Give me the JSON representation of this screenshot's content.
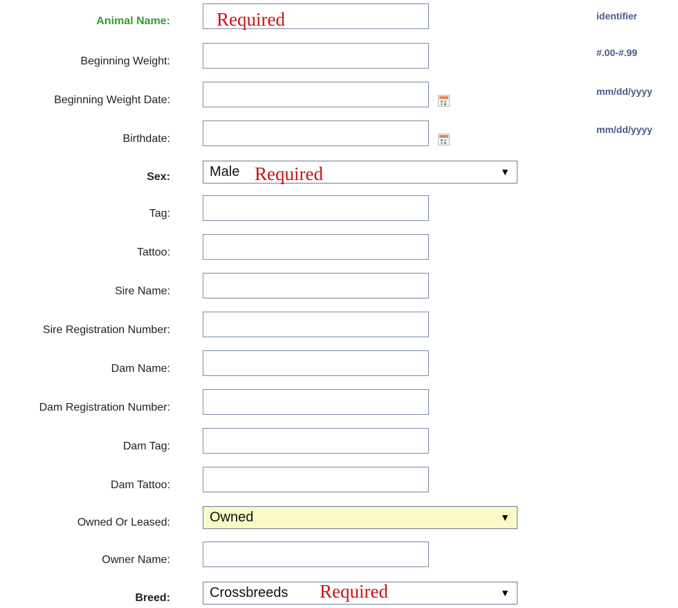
{
  "form": {
    "animal_name": {
      "label": "Animal Name:",
      "value": "",
      "required_note": "Required",
      "hint": "identifier"
    },
    "beginning_weight": {
      "label": "Beginning Weight:",
      "value": "",
      "hint": "#.00-#.99"
    },
    "beginning_weight_date": {
      "label": "Beginning Weight Date:",
      "value": "",
      "hint": "mm/dd/yyyy"
    },
    "birthdate": {
      "label": "Birthdate:",
      "value": "",
      "hint": "mm/dd/yyyy"
    },
    "sex": {
      "label": "Sex:",
      "selected": "Male",
      "required_note": "Required"
    },
    "tag": {
      "label": "Tag:",
      "value": ""
    },
    "tattoo": {
      "label": "Tattoo:",
      "value": ""
    },
    "sire_name": {
      "label": "Sire Name:",
      "value": ""
    },
    "sire_registration_number": {
      "label": "Sire Registration Number:",
      "value": ""
    },
    "dam_name": {
      "label": "Dam Name:",
      "value": ""
    },
    "dam_registration_number": {
      "label": "Dam Registration Number:",
      "value": ""
    },
    "dam_tag": {
      "label": "Dam Tag:",
      "value": ""
    },
    "dam_tattoo": {
      "label": "Dam Tattoo:",
      "value": ""
    },
    "owned_or_leased": {
      "label": "Owned Or Leased:",
      "selected": "Owned"
    },
    "owner_name": {
      "label": "Owner Name:",
      "value": ""
    },
    "breed": {
      "label": "Breed:",
      "selected": "Crossbreeds",
      "required_note": "Required"
    }
  },
  "icons": {
    "calendar": "calendar-icon",
    "dropdown_arrow": "▼"
  },
  "colors": {
    "required_label": "#3a9a3a",
    "required_note": "#cc1111",
    "hint_text": "#4a5a8a",
    "highlight_select": "#fafac8",
    "field_border": "#7a8aa8"
  }
}
